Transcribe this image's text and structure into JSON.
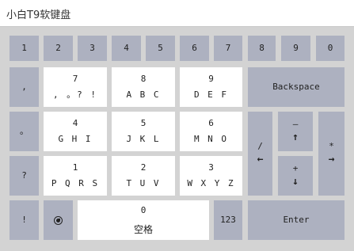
{
  "window": {
    "title": "小白T9软键盘"
  },
  "numbers_row": [
    "1",
    "2",
    "3",
    "4",
    "5",
    "6",
    "7",
    "8",
    "9",
    "0"
  ],
  "left_column": {
    "comma": ",",
    "period": "。",
    "question": "?",
    "exclaim": "!"
  },
  "t9": {
    "k7": {
      "digit": "7",
      "letters": ", 。? !"
    },
    "k8": {
      "digit": "8",
      "letters": "A B C"
    },
    "k9": {
      "digit": "9",
      "letters": "D E F"
    },
    "k4": {
      "digit": "4",
      "letters": "G H I"
    },
    "k5": {
      "digit": "5",
      "letters": "J K L"
    },
    "k6": {
      "digit": "6",
      "letters": "M N O"
    },
    "k1": {
      "digit": "1",
      "letters": "P Q R S"
    },
    "k2": {
      "digit": "2",
      "letters": "T U V"
    },
    "k3": {
      "digit": "3",
      "letters": "W X Y Z"
    },
    "k0": {
      "digit": "0",
      "label": "空格"
    }
  },
  "backspace": "Backspace",
  "slash_left": {
    "symbol": "/",
    "arrow": "←"
  },
  "minus_up": {
    "symbol": "–",
    "arrow": "↑"
  },
  "plus_down": {
    "symbol": "+",
    "arrow": "↓"
  },
  "star_right": {
    "symbol": "*",
    "arrow": "→"
  },
  "mode_button": "123",
  "enter": "Enter",
  "icons": {
    "language": "globe-icon"
  },
  "colors": {
    "key_gray": "#adb1c0",
    "key_white": "#ffffff",
    "background": "#d3d3d3"
  }
}
